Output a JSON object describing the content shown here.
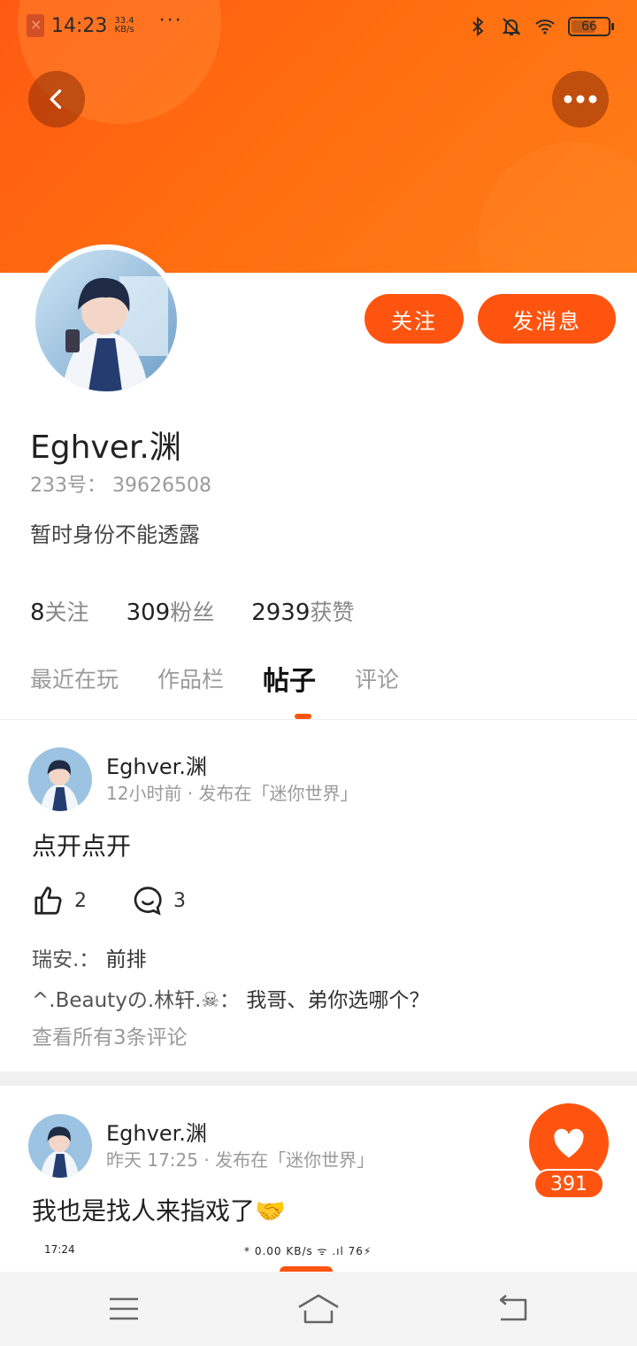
{
  "status_bar": {
    "time": "14:23",
    "speed_value": "33.4",
    "speed_unit": "KB/s",
    "more": "···",
    "battery": "66"
  },
  "profile": {
    "name": "Eghver.渊",
    "uid_text": "233号： 39626508",
    "bio": "暂时身份不能透露",
    "follow_label": "关注",
    "message_label": "发消息",
    "stats": {
      "following_count": "8",
      "following_label": "关注",
      "fans_count": "309",
      "fans_label": "粉丝",
      "likes_count": "2939",
      "likes_label": "获赞"
    }
  },
  "tabs": [
    "最近在玩",
    "作品栏",
    "帖子",
    "评论"
  ],
  "active_tab": "帖子",
  "posts": [
    {
      "author": "Eghver.渊",
      "meta": "12小时前 · 发布在「迷你世界」",
      "text": "点开点开",
      "likes": "2",
      "comments": "3",
      "comment_lines": [
        {
          "author": "瑞安.：",
          "text": "前排"
        },
        {
          "author": "^.Beautyの.林轩.☠：",
          "text": "我哥、弟你选哪个？"
        }
      ],
      "view_all": "查看所有3条评论"
    },
    {
      "author": "Eghver.渊",
      "meta": "昨天 17:25 · 发布在「迷你世界」",
      "text": "我也是找人来指戏了🤝"
    }
  ],
  "floating_like": {
    "count": "391"
  },
  "embedded_screenshot": {
    "time": "17:24",
    "right": "* 0.00 KB/s ᯤ .ıl 76⚡"
  },
  "colors": {
    "accent": "#ff540f",
    "banner": "#ff6d0f"
  }
}
